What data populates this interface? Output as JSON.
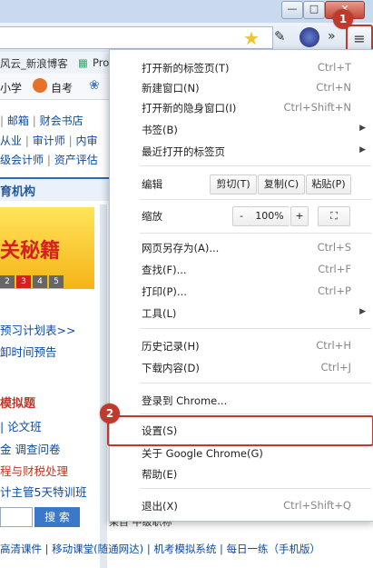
{
  "browser": {
    "window_buttons": {
      "minimize": "—",
      "maximize": "□",
      "close": "✕"
    },
    "extension_chevron": "»",
    "menu_button": "≡",
    "bookmarks": [
      "风云_新浪博客",
      "Pro"
    ],
    "toolbar2": [
      "小学",
      "自考",
      "❀"
    ]
  },
  "page": {
    "row1": [
      "|",
      "邮箱",
      "|",
      "财会书店"
    ],
    "row2": [
      "从业",
      "|",
      "审计师",
      "|",
      "内审"
    ],
    "row3": [
      "级会计师",
      "|",
      "资产评估"
    ],
    "section_header": "育机构",
    "banner_text": "关秘籍",
    "pager": [
      "2",
      "3",
      "4",
      "5"
    ],
    "active_page": "3",
    "links_block1": [
      "预习计划表>>",
      "卸时间预告"
    ],
    "section2_title": "模拟题",
    "links_block2": [
      "| 论文班",
      "金  调查问卷",
      "程与财税处理",
      "计主管5天特训班"
    ],
    "search_button": "搜 索",
    "footer": "高清课件 | 移动课堂(随通网达) | 机考模拟系统 | 每日一练（手机版）",
    "background_fragment": "果目  中级职称"
  },
  "menu": {
    "items1": [
      {
        "label": "打开新的标签页(T)",
        "shortcut": "Ctrl+T"
      },
      {
        "label": "新建窗口(N)",
        "shortcut": "Ctrl+N"
      },
      {
        "label": "打开新的隐身窗口(I)",
        "shortcut": "Ctrl+Shift+N"
      },
      {
        "label": "书签(B)",
        "shortcut": ""
      },
      {
        "label": "最近打开的标签页",
        "shortcut": ""
      }
    ],
    "edit": {
      "label": "编辑",
      "cut": "剪切(T)",
      "copy": "复制(C)",
      "paste": "粘贴(P)"
    },
    "zoom": {
      "label": "缩放",
      "minus": "-",
      "value": "100%",
      "plus": "+",
      "fullscreen": "⛶"
    },
    "items2": [
      {
        "label": "网页另存为(A)...",
        "shortcut": "Ctrl+S"
      },
      {
        "label": "查找(F)...",
        "shortcut": "Ctrl+F"
      },
      {
        "label": "打印(P)...",
        "shortcut": "Ctrl+P"
      },
      {
        "label": "工具(L)",
        "shortcut": ""
      }
    ],
    "items3": [
      {
        "label": "历史记录(H)",
        "shortcut": "Ctrl+H"
      },
      {
        "label": "下载内容(D)",
        "shortcut": "Ctrl+J"
      }
    ],
    "signin": "登录到 Chrome...",
    "items4": [
      {
        "label": "设置(S)",
        "shortcut": ""
      },
      {
        "label": "关于 Google Chrome(G)",
        "shortcut": ""
      },
      {
        "label": "帮助(E)",
        "shortcut": ""
      }
    ],
    "exit": {
      "label": "退出(X)",
      "shortcut": "Ctrl+Shift+Q"
    }
  },
  "badges": {
    "step1": "1",
    "step2": "2"
  }
}
